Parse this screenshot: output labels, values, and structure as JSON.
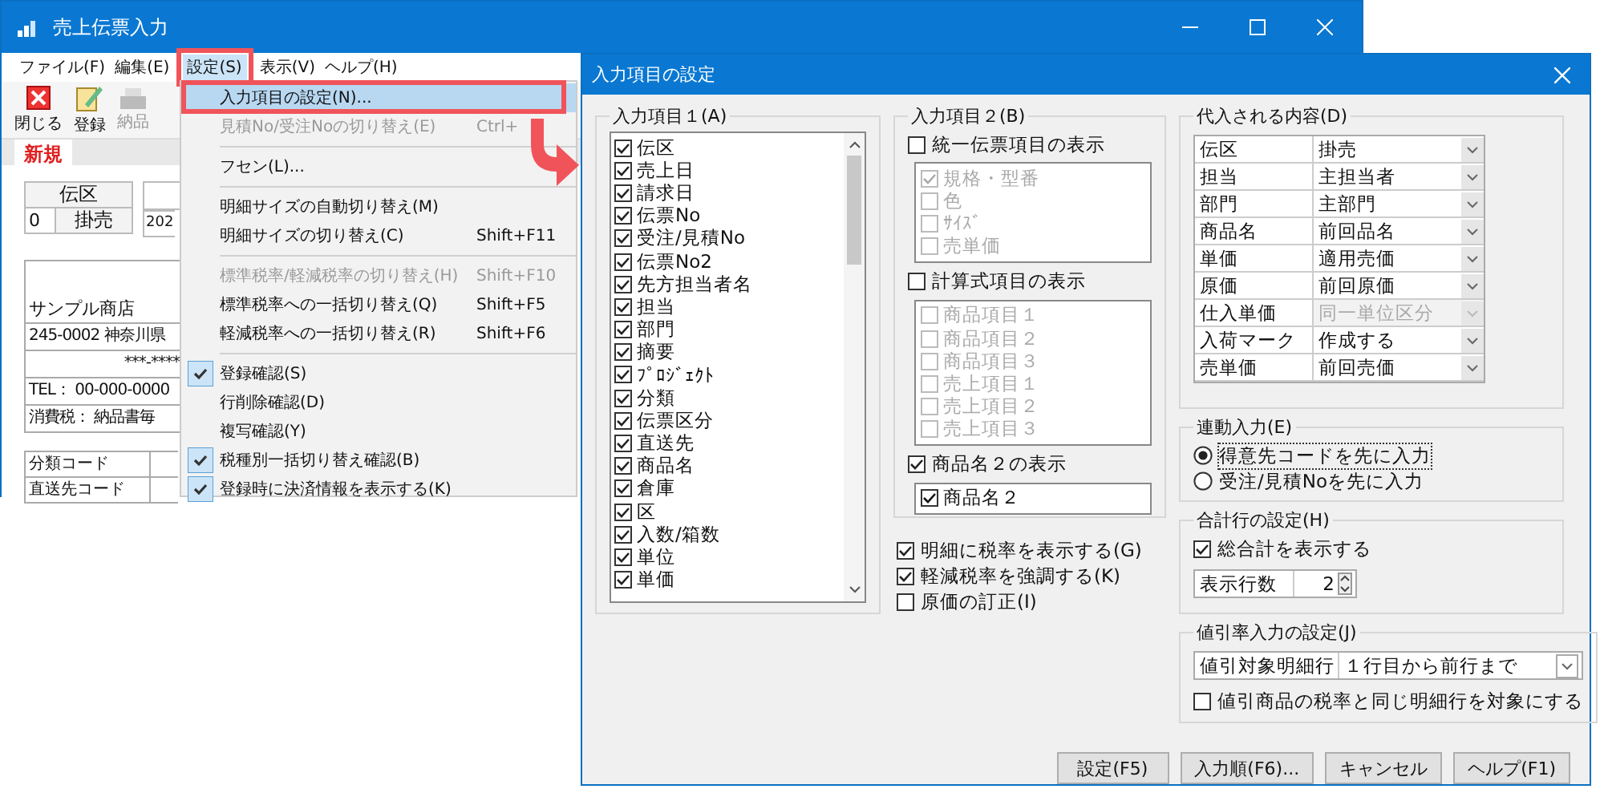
{
  "main_window": {
    "title": "売上伝票入力",
    "menu": [
      {
        "label": "ファイル(F)",
        "selected": false
      },
      {
        "label": "編集(E)",
        "selected": false
      },
      {
        "label": "設定(S)",
        "selected": true
      },
      {
        "label": "表示(V)",
        "selected": false
      },
      {
        "label": "ヘルプ(H)",
        "selected": false
      }
    ],
    "toolbar": [
      {
        "label": "閉じる",
        "kind": "close",
        "disabled": false
      },
      {
        "label": "登録",
        "kind": "register",
        "disabled": false
      },
      {
        "label": "納品",
        "kind": "print",
        "disabled": true
      }
    ],
    "mode_tab": "新規",
    "form": {
      "slip_type_header": "伝区",
      "slip_type_code": "0",
      "slip_type_value": "掛売",
      "date": "202",
      "customer_name": "サンプル商店",
      "address": "245-0002 神奈川県",
      "address_line2": "***-****",
      "tel": "TEL： 00-000-0000",
      "tax": "消費税： 納品書毎",
      "field_labels": [
        "分類コード",
        "直送先コード"
      ]
    }
  },
  "menu_dropdown": [
    {
      "kind": "item",
      "label": "入力項目の設定(N)...",
      "checked": false,
      "disabled": false,
      "selected": true
    },
    {
      "kind": "item",
      "label": "見積No/受注Noの切り替え(E)",
      "shortcut": "Ctrl+",
      "checked": false,
      "disabled": true,
      "selected": false
    },
    {
      "kind": "separator"
    },
    {
      "kind": "item",
      "label": "フセン(L)...",
      "checked": false,
      "disabled": false,
      "selected": false
    },
    {
      "kind": "separator"
    },
    {
      "kind": "item",
      "label": "明細サイズの自動切り替え(M)",
      "checked": false,
      "disabled": false,
      "selected": false
    },
    {
      "kind": "item",
      "label": "明細サイズの切り替え(C)",
      "shortcut": "Shift+F11",
      "checked": false,
      "disabled": false,
      "selected": false
    },
    {
      "kind": "separator"
    },
    {
      "kind": "item",
      "label": "標準税率/軽減税率の切り替え(H)",
      "shortcut": "Shift+F10",
      "checked": false,
      "disabled": true,
      "selected": false
    },
    {
      "kind": "item",
      "label": "標準税率への一括切り替え(Q)",
      "shortcut": "Shift+F5",
      "checked": false,
      "disabled": false,
      "selected": false
    },
    {
      "kind": "item",
      "label": "軽減税率への一括切り替え(R)",
      "shortcut": "Shift+F6",
      "checked": false,
      "disabled": false,
      "selected": false
    },
    {
      "kind": "separator"
    },
    {
      "kind": "item",
      "label": "登録確認(S)",
      "checked": true,
      "disabled": false,
      "selected": false
    },
    {
      "kind": "item",
      "label": "行削除確認(D)",
      "checked": false,
      "disabled": false,
      "selected": false
    },
    {
      "kind": "item",
      "label": "複写確認(Y)",
      "checked": false,
      "disabled": false,
      "selected": false
    },
    {
      "kind": "item",
      "label": "税種別一括切り替え確認(B)",
      "checked": true,
      "disabled": false,
      "selected": false
    },
    {
      "kind": "item",
      "label": "登録時に決済情報を表示する(K)",
      "checked": true,
      "disabled": false,
      "selected": false
    }
  ],
  "dialog": {
    "title": "入力項目の設定",
    "items1": {
      "label": "入力項目１(A)",
      "items": [
        {
          "label": "伝区",
          "checked": true
        },
        {
          "label": "売上日",
          "checked": true
        },
        {
          "label": "請求日",
          "checked": true
        },
        {
          "label": "伝票No",
          "checked": true
        },
        {
          "label": "受注/見積No",
          "checked": true
        },
        {
          "label": "伝票No2",
          "checked": true
        },
        {
          "label": "先方担当者名",
          "checked": true
        },
        {
          "label": "担当",
          "checked": true
        },
        {
          "label": "部門",
          "checked": true
        },
        {
          "label": "摘要",
          "checked": true
        },
        {
          "label": "ﾌﾟﾛｼﾞｪｸﾄ",
          "checked": true
        },
        {
          "label": "分類",
          "checked": true
        },
        {
          "label": "伝票区分",
          "checked": true
        },
        {
          "label": "直送先",
          "checked": true
        },
        {
          "label": "商品名",
          "checked": true
        },
        {
          "label": "倉庫",
          "checked": true
        },
        {
          "label": "区",
          "checked": true
        },
        {
          "label": "入数/箱数",
          "checked": true
        },
        {
          "label": "単位",
          "checked": true
        },
        {
          "label": "単価",
          "checked": true
        }
      ]
    },
    "items2": {
      "label": "入力項目２(B)",
      "sections": [
        {
          "label": "統一伝票項目の表示",
          "checked": false,
          "items": [
            {
              "label": "規格・型番",
              "checked": true
            },
            {
              "label": "色",
              "checked": false
            },
            {
              "label": "ｻｲｽﾞ",
              "checked": false
            },
            {
              "label": "売単価",
              "checked": false
            }
          ]
        },
        {
          "label": "計算式項目の表示",
          "checked": false,
          "items": [
            {
              "label": "商品項目１",
              "checked": false
            },
            {
              "label": "商品項目２",
              "checked": false
            },
            {
              "label": "商品項目３",
              "checked": false
            },
            {
              "label": "売上項目１",
              "checked": false
            },
            {
              "label": "売上項目２",
              "checked": false
            },
            {
              "label": "売上項目３",
              "checked": false
            }
          ]
        },
        {
          "label": "商品名２の表示",
          "checked": true,
          "items": [
            {
              "label": "商品名２",
              "checked": true
            }
          ]
        }
      ]
    },
    "options": [
      {
        "label": "明細に税率を表示する(G)",
        "checked": true
      },
      {
        "label": "軽減税率を強調する(K)",
        "checked": true
      },
      {
        "label": "原価の訂正(I)",
        "checked": false
      }
    ],
    "substitution": {
      "label": "代入される内容(D)",
      "rows": [
        {
          "name": "伝区",
          "value": "掛売",
          "disabled": false
        },
        {
          "name": "担当",
          "value": "主担当者",
          "disabled": false
        },
        {
          "name": "部門",
          "value": "主部門",
          "disabled": false
        },
        {
          "name": "商品名",
          "value": "前回品名",
          "disabled": false
        },
        {
          "name": "単価",
          "value": "適用売価",
          "disabled": false
        },
        {
          "name": "原価",
          "value": "前回原価",
          "disabled": false
        },
        {
          "name": "仕入単価",
          "value": "同一単位区分",
          "disabled": true
        },
        {
          "name": "入荷マーク",
          "value": "作成する",
          "disabled": false
        },
        {
          "name": "売単価",
          "value": "前回売価",
          "disabled": false
        }
      ]
    },
    "linked_input": {
      "label": "連動入力(E)",
      "options": [
        {
          "label": "得意先コードを先に入力",
          "selected": true
        },
        {
          "label": "受注/見積Noを先に入力",
          "selected": false
        }
      ]
    },
    "total_row": {
      "label": "合計行の設定(H)",
      "show_total": {
        "label": "総合計を表示する",
        "checked": true
      },
      "rows_label": "表示行数",
      "rows_value": "2"
    },
    "discount": {
      "label": "値引率入力の設定(J)",
      "target_label": "値引対象明細行",
      "target_value": "１行目から前行まで",
      "same_rate": {
        "label": "値引商品の税率と同じ明細行を対象にする",
        "checked": false
      }
    },
    "buttons": [
      "設定(F5)",
      "入力順(F6)...",
      "キャンセル",
      "ヘルプ(F1)"
    ]
  }
}
